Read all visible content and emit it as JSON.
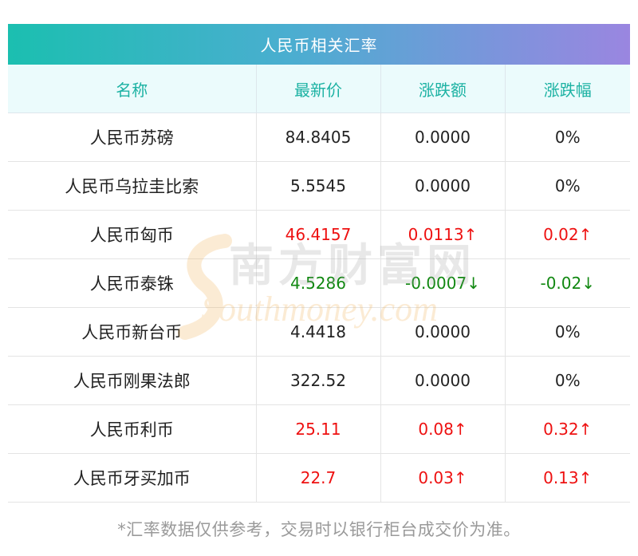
{
  "title": "人民币相关汇率",
  "columns": [
    "名称",
    "最新价",
    "涨跌额",
    "涨跌幅"
  ],
  "rows": [
    {
      "name": "人民币苏磅",
      "price": "84.8405",
      "change": "0.0000",
      "pct": "0%",
      "trend": "flat"
    },
    {
      "name": "人民币乌拉圭比索",
      "price": "5.5545",
      "change": "0.0000",
      "pct": "0%",
      "trend": "flat"
    },
    {
      "name": "人民币匈币",
      "price": "46.4157",
      "change": "0.0113↑",
      "pct": "0.02↑",
      "trend": "up"
    },
    {
      "name": "人民币泰铢",
      "price": "4.5286",
      "change": "-0.0007↓",
      "pct": "-0.02↓",
      "trend": "down"
    },
    {
      "name": "人民币新台币",
      "price": "4.4418",
      "change": "0.0000",
      "pct": "0%",
      "trend": "flat"
    },
    {
      "name": "人民币刚果法郎",
      "price": "322.52",
      "change": "0.0000",
      "pct": "0%",
      "trend": "flat"
    },
    {
      "name": "人民币利币",
      "price": "25.11",
      "change": "0.08↑",
      "pct": "0.32↑",
      "trend": "up"
    },
    {
      "name": "人民币牙买加币",
      "price": "22.7",
      "change": "0.03↑",
      "pct": "0.13↑",
      "trend": "up"
    }
  ],
  "watermark": {
    "cn": "南方财富网",
    "en": "Southmoney.com"
  },
  "footnote": "*汇率数据仅供参考，交易时以银行柜台成交价为准。",
  "colors": {
    "up": "#ee1111",
    "down": "#118811",
    "header_text": "#1cb2a3",
    "header_bg": "#ebfbfc",
    "title_gradient": [
      "#1bbfb0",
      "#9a86e0"
    ]
  }
}
